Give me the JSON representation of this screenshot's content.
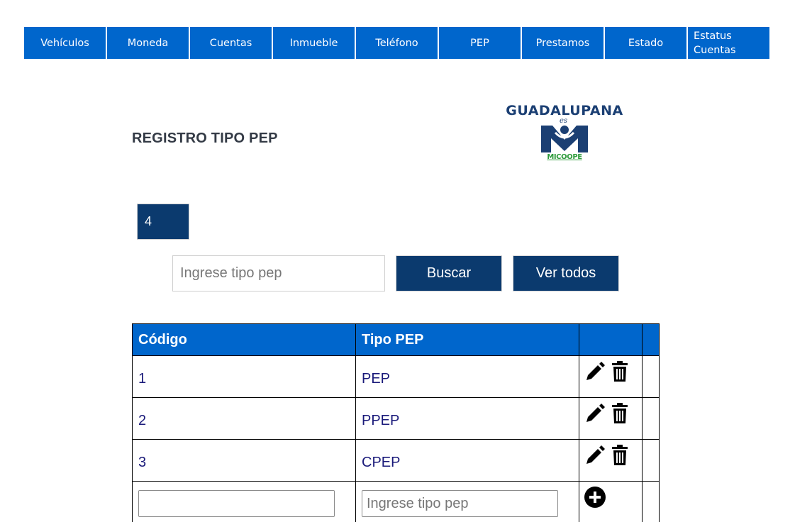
{
  "nav": {
    "items": [
      {
        "label": "Vehículos"
      },
      {
        "label": "Moneda"
      },
      {
        "label": "Cuentas"
      },
      {
        "label": "Inmueble"
      },
      {
        "label": "Teléfono"
      },
      {
        "label": "PEP"
      },
      {
        "label": "Prestamos"
      },
      {
        "label": "Estado"
      },
      {
        "label": "Estatus Cuentas"
      }
    ]
  },
  "page": {
    "title": "REGISTRO TIPO PEP"
  },
  "logo": {
    "name": "GUADALUPANA",
    "tagline": "es",
    "sub": "MICOOPE"
  },
  "counter": {
    "value": "4"
  },
  "search": {
    "placeholder": "Ingrese tipo pep",
    "value": "",
    "search_button": "Buscar",
    "view_all_button": "Ver todos"
  },
  "table": {
    "headers": {
      "code": "Código",
      "type": "Tipo PEP"
    },
    "rows": [
      {
        "code": "1",
        "type": "PEP"
      },
      {
        "code": "2",
        "type": "PPEP"
      },
      {
        "code": "3",
        "type": "CPEP"
      }
    ],
    "new_row": {
      "code_value": "",
      "type_placeholder": "Ingrese tipo pep"
    }
  },
  "icons": {
    "edit": "pencil-icon",
    "delete": "trash-icon",
    "add": "plus-circle-icon"
  },
  "colors": {
    "nav_bg": "#0066cc",
    "header_bg": "#0066cc",
    "button_bg": "#0b3a6e",
    "text_link": "#1a1a7a"
  }
}
